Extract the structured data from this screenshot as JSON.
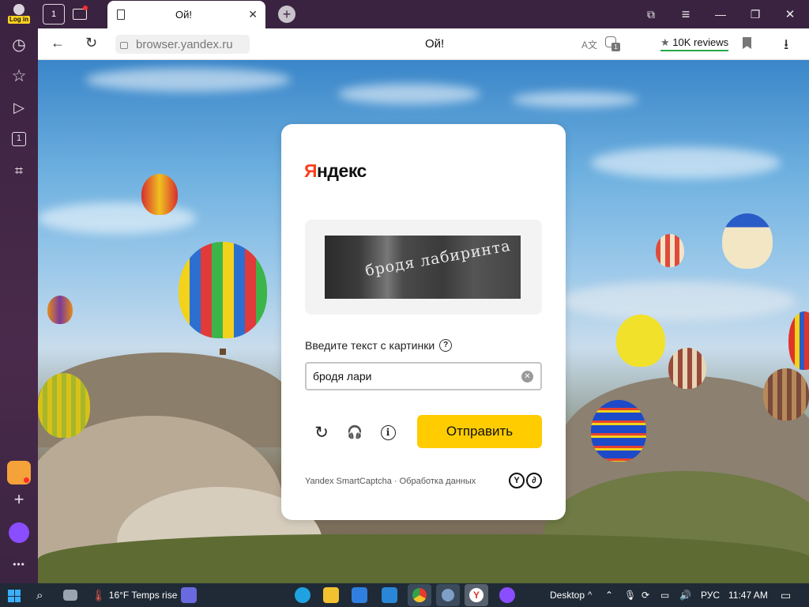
{
  "sidebar": {
    "login_label": "Log in",
    "items": [
      {
        "name": "history-icon",
        "glyph": "◷"
      },
      {
        "name": "bookmarks-star-icon",
        "glyph": "☆"
      },
      {
        "name": "video-play-icon",
        "glyph": "▷"
      },
      {
        "name": "tab-counter-icon",
        "glyph": "1"
      },
      {
        "name": "screenshot-camera-icon",
        "glyph": "⌗"
      }
    ],
    "bottom_more": "•••"
  },
  "tabstrip": {
    "home_counter": "1",
    "tab_title": "Ой!",
    "tab_close": "✕",
    "new_tab": "+"
  },
  "window": {
    "collections": "⧉",
    "menu": "≡",
    "minimize": "—",
    "restore": "❐",
    "close": "✕"
  },
  "addressbar": {
    "back": "←",
    "reload": "↻",
    "url": "browser.yandex.ru",
    "page_title": "Ой!",
    "reviews_star": "★",
    "reviews_label": "10K reviews",
    "translate": "A文",
    "alice_count": "1",
    "bookmark": "🔖",
    "download": "⭳"
  },
  "captcha": {
    "logo_first": "Я",
    "logo_rest": "ндекс",
    "captcha_text": "бродя лабиринта",
    "prompt": "Введите текст с картинки",
    "help": "?",
    "input_value": "бродя лари",
    "clear": "✕",
    "refresh": "↻",
    "audio": "🎧",
    "info": "i",
    "submit_label": "Отправить",
    "footer": "Yandex SmartCaptcha · Обработка данных",
    "logo1": "Y",
    "logo2": "∂"
  },
  "taskbar": {
    "weather": "16°F Temps rise",
    "desktop": "Desktop",
    "chevron": "^",
    "lang": "РУС",
    "time": "11:47 AM"
  }
}
